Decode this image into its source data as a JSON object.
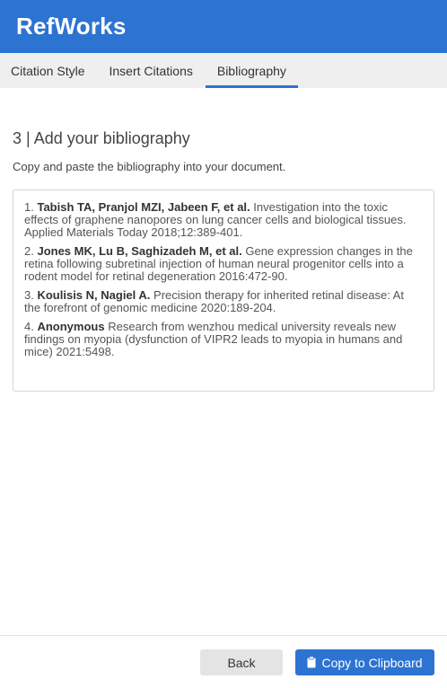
{
  "app": {
    "title": "RefWorks"
  },
  "tabs": [
    {
      "label": "Citation Style",
      "active": false
    },
    {
      "label": "Insert Citations",
      "active": false
    },
    {
      "label": "Bibliography",
      "active": true
    }
  ],
  "main": {
    "step_title": "3 | Add your bibliography",
    "instruction": "Copy and paste the bibliography into your document.",
    "entries": [
      {
        "number": "1.",
        "authors": "Tabish TA, Pranjol MZI, Jabeen F, et al.",
        "text": "Investigation into the toxic effects of graphene nanopores on lung cancer cells and biological tissues. Applied Materials Today 2018;12:389-401."
      },
      {
        "number": "2.",
        "authors": "Jones MK, Lu B, Saghizadeh M, et al.",
        "text": "Gene expression changes in the retina following subretinal injection of human neural progenitor cells into a rodent model for retinal degeneration 2016:472-90."
      },
      {
        "number": "3.",
        "authors": "Koulisis N, Nagiel A.",
        "text": "Precision therapy for inherited retinal disease: At the forefront of genomic medicine 2020:189-204."
      },
      {
        "number": "4.",
        "authors": "Anonymous",
        "text": "Research from wenzhou medical university reveals new findings on myopia (dysfunction of VIPR2 leads to myopia in humans and mice) 2021:5498."
      }
    ]
  },
  "footer": {
    "back_label": "Back",
    "copy_label": "Copy to Clipboard",
    "copy_icon": "clipboard-icon"
  },
  "colors": {
    "brand": "#2c73d2",
    "tab_bar": "#efefef",
    "back_button": "#e4e4e4"
  }
}
